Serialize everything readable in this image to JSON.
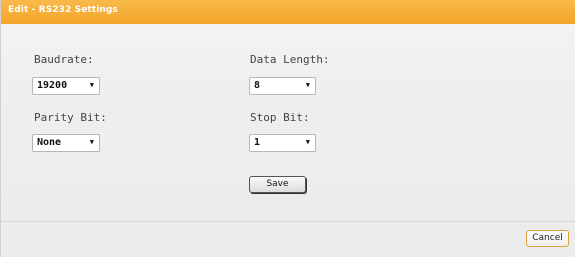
{
  "dialog": {
    "title": "Edit - RS232 Settings",
    "accent_color": "#f3a52a"
  },
  "form": {
    "baudrate": {
      "label": "Baudrate:",
      "value": "19200",
      "arrow": "▼"
    },
    "data_length": {
      "label": "Data Length:",
      "value": "8",
      "arrow": "▼"
    },
    "parity_bit": {
      "label": "Parity Bit:",
      "value": "None",
      "arrow": "▼"
    },
    "stop_bit": {
      "label": "Stop Bit:",
      "value": "1",
      "arrow": "▼"
    },
    "save_label": "Save"
  },
  "footer": {
    "cancel_label": "Cancel"
  }
}
